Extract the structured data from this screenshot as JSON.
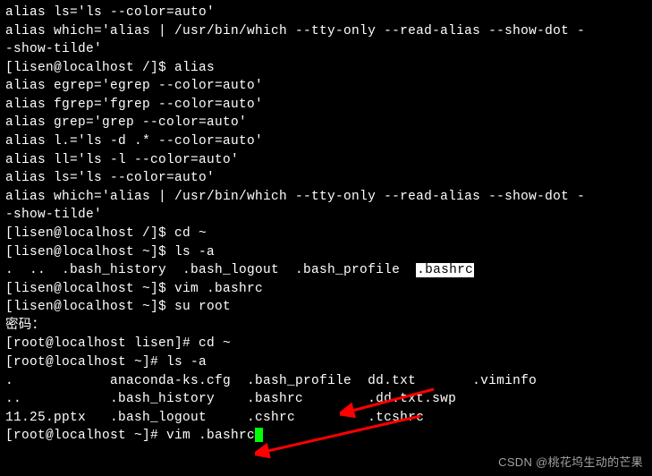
{
  "lines": {
    "l01": "alias ls='ls --color=auto'",
    "l02": "alias which='alias | /usr/bin/which --tty-only --read-alias --show-dot -",
    "l03": "-show-tilde'",
    "l04": "[lisen@localhost /]$ alias",
    "l05": "alias egrep='egrep --color=auto'",
    "l06": "alias fgrep='fgrep --color=auto'",
    "l07": "alias grep='grep --color=auto'",
    "l08": "alias l.='ls -d .* --color=auto'",
    "l09": "alias ll='ls -l --color=auto'",
    "l10": "alias ls='ls --color=auto'",
    "l11": "alias which='alias | /usr/bin/which --tty-only --read-alias --show-dot -",
    "l12": "-show-tilde'",
    "l13": "[lisen@localhost /]$ cd ~",
    "l14": "[lisen@localhost ~]$ ls -a",
    "l15a": ".  ..  .bash_history  .bash_logout  .bash_profile  ",
    "l15b": ".bashrc",
    "l16": "[lisen@localhost ~]$ vim .bashrc",
    "l17": "[lisen@localhost ~]$ su root",
    "l18": "密码：",
    "l19": "[root@localhost lisen]# cd ~",
    "l20": "[root@localhost ~]# ls -a",
    "l21": ".            anaconda-ks.cfg  .bash_profile  dd.txt       .viminfo",
    "l22": "..           .bash_history    .bashrc        .dd.txt.swp",
    "l23": "11.25.pptx   .bash_logout     .cshrc         .tcshrc",
    "l24": "[root@localhost ~]# vim .bashrc"
  },
  "watermark": "CSDN @桃花坞生动的芒果"
}
